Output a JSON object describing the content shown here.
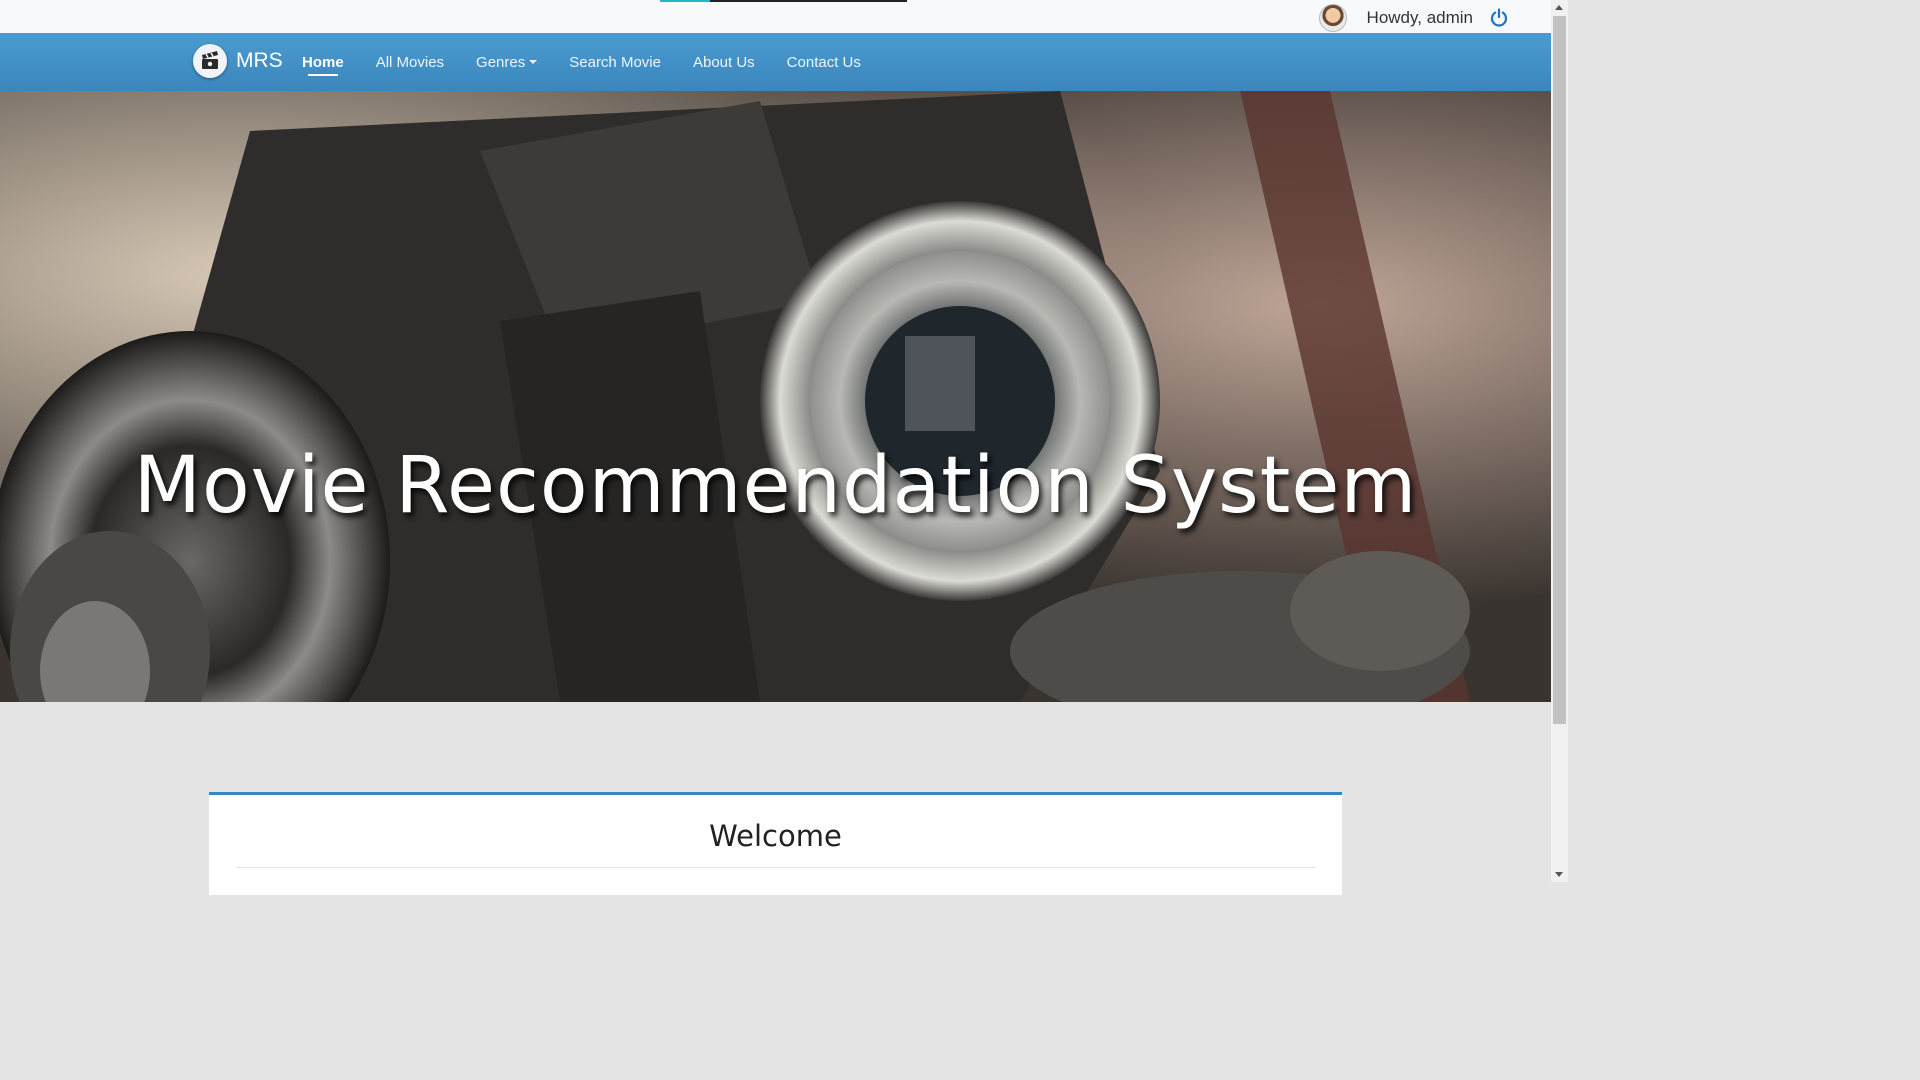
{
  "topbar": {
    "greeting": "Howdy, admin"
  },
  "navbar": {
    "brand": "MRS",
    "items": [
      {
        "label": "Home",
        "active": true
      },
      {
        "label": "All Movies"
      },
      {
        "label": "Genres",
        "dropdown": true
      },
      {
        "label": "Search Movie"
      },
      {
        "label": "About Us"
      },
      {
        "label": "Contact Us"
      }
    ]
  },
  "hero": {
    "title": "Movie Recommendation System"
  },
  "main": {
    "welcome_title": "Welcome"
  },
  "colors": {
    "navbar": "#3a86bd",
    "power_icon": "#1a73c7"
  },
  "icons": [
    "user-avatar",
    "power-icon",
    "clapperboard-logo"
  ]
}
